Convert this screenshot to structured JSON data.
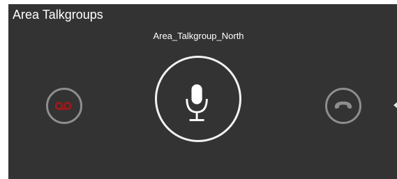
{
  "panel": {
    "title": "Area Talkgroups",
    "talkgroup_name": "Area_Talkgroup_North"
  },
  "buttons": {
    "voicemail_icon": "voicemail-icon",
    "ptt_icon": "microphone-icon",
    "hangup_icon": "phone-hangup-icon"
  },
  "colors": {
    "panel_background": "#333333",
    "ptt_ring": "#f2f2f2",
    "side_ring": "#8e8e8e",
    "voicemail_icon": "#a01818",
    "text": "#ffffff"
  }
}
